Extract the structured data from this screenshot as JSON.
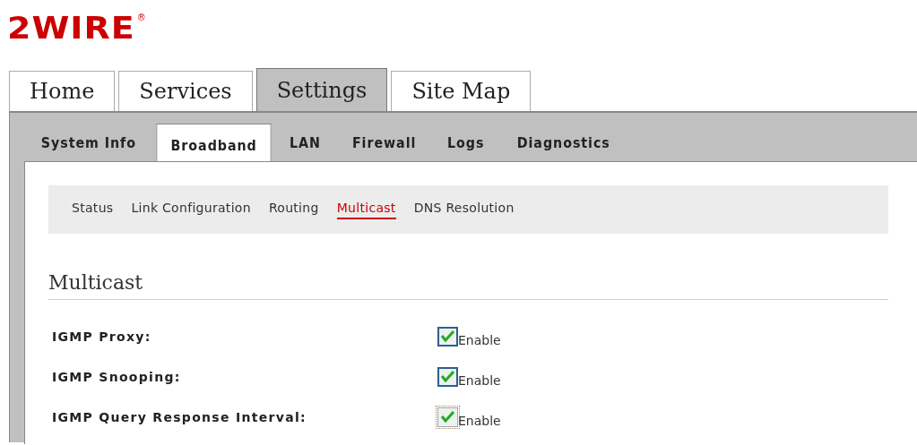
{
  "logo": {
    "text": "2WIRE",
    "mark": "®"
  },
  "main_tabs": [
    {
      "label": "Home",
      "selected": false
    },
    {
      "label": "Services",
      "selected": false
    },
    {
      "label": "Settings",
      "selected": true
    },
    {
      "label": "Site Map",
      "selected": false
    }
  ],
  "sub_tabs": [
    {
      "label": "System Info",
      "selected": false
    },
    {
      "label": "Broadband",
      "selected": true
    },
    {
      "label": "LAN",
      "selected": false
    },
    {
      "label": "Firewall",
      "selected": false
    },
    {
      "label": "Logs",
      "selected": false
    },
    {
      "label": "Diagnostics",
      "selected": false
    }
  ],
  "section_nav": [
    {
      "label": "Status",
      "selected": false
    },
    {
      "label": "Link Configuration",
      "selected": false
    },
    {
      "label": "Routing",
      "selected": false
    },
    {
      "label": "Multicast",
      "selected": true
    },
    {
      "label": "DNS Resolution",
      "selected": false
    }
  ],
  "heading": "Multicast",
  "settings": [
    {
      "label": "IGMP Proxy:",
      "checked": true,
      "focused": false,
      "option": "Enable"
    },
    {
      "label": "IGMP Snooping:",
      "checked": true,
      "focused": false,
      "option": "Enable"
    },
    {
      "label": "IGMP Query Response Interval:",
      "checked": true,
      "focused": true,
      "option": "Enable"
    }
  ]
}
